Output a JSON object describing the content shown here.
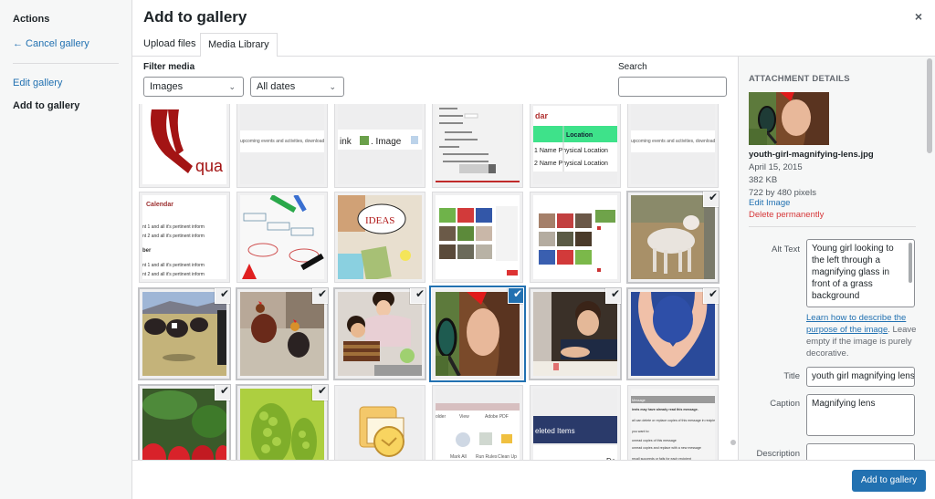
{
  "menu": {
    "heading": "Actions",
    "cancel": "← Cancel gallery",
    "edit": "Edit gallery",
    "active": "Add to gallery"
  },
  "modal": {
    "title": "Add to gallery",
    "close_icon": "×"
  },
  "tabs": [
    {
      "label": "Upload files",
      "active": false
    },
    {
      "label": "Media Library",
      "active": true
    }
  ],
  "toolbar": {
    "filter_label": "Filter media",
    "type_filter": "Images",
    "date_filter": "All dates",
    "search_label": "Search",
    "search_value": ""
  },
  "grid": {
    "items": [
      {
        "desc": "qua logo (red Q)",
        "selected": false
      },
      {
        "desc": "upcoming events text strip",
        "text": "upcoming events and activities, download",
        "selected": false
      },
      {
        "desc": "ink Image toolbar",
        "text": "ink  . Image",
        "selected": false
      },
      {
        "desc": "table properties dialog",
        "selected": false
      },
      {
        "desc": "calendar table",
        "text_a": "dar",
        "text_b": "Location",
        "text_c": "1 Name  Physical Location",
        "text_d": "2 Name  Physical Location",
        "selected": false
      },
      {
        "desc": "upcoming events text strip",
        "text": "upcoming events and activities, download",
        "selected": false
      },
      {
        "desc": "calendar document",
        "text_a": "Calendar",
        "text_b": "nt 1 and all it's pertinent inform",
        "text_c": "nt 2 and all it's pertinent inform",
        "text_d": "ber",
        "selected": false
      },
      {
        "desc": "flowchart with markers",
        "selected": false
      },
      {
        "desc": "IDEAS sketch board",
        "text": "IDEAS",
        "selected": false
      },
      {
        "desc": "edit gallery screenshot",
        "selected": false
      },
      {
        "desc": "create gallery screenshot",
        "selected": false
      },
      {
        "desc": "lamb",
        "selected": true
      },
      {
        "desc": "cows in field",
        "selected": true
      },
      {
        "desc": "chickens",
        "selected": true
      },
      {
        "desc": "mother and son washing lettuce",
        "selected": true
      },
      {
        "desc": "girl with magnifying glass",
        "selected": true,
        "details": true
      },
      {
        "desc": "boy writing",
        "selected": true
      },
      {
        "desc": "blueberries in hands",
        "selected": true
      },
      {
        "desc": "strawberries",
        "selected": true
      },
      {
        "desc": "green grapes",
        "selected": true
      },
      {
        "desc": "outlook icon",
        "selected": false
      },
      {
        "desc": "outlook ribbon",
        "text_a": "older  View  Adobe PDF",
        "text_b": "Mark All as Read  Run Rules Now  Clean Up Folder",
        "selected": false
      },
      {
        "desc": "deleted items banner",
        "text": "eleted Items",
        "selected": false
      },
      {
        "desc": "recall message dialog",
        "text": "ients may have already read this message.",
        "selected": false
      }
    ]
  },
  "details": {
    "heading": "Attachment Details",
    "filename": "youth-girl-magnifying-lens.jpg",
    "date": "April 15, 2015",
    "size": "382 KB",
    "dimensions": "722 by 480 pixels",
    "edit_link": "Edit Image",
    "delete_link": "Delete permanently",
    "alt_label": "Alt Text",
    "alt_value": "Young girl looking to the left through a magnifying glass in front of a grass background",
    "help_link": "Learn how to describe the purpose of the image",
    "help_text": ". Leave empty if the image is purely decorative.",
    "title_label": "Title",
    "title_value": "youth girl magnifying lens",
    "caption_label": "Caption",
    "caption_value": "Magnifying lens",
    "description_label": "Description",
    "description_value": ""
  },
  "footer": {
    "primary_button": "Add to gallery"
  },
  "colors": {
    "accent": "#2271b1",
    "danger": "#d63638",
    "sidebar_bg": "#f6f7f7"
  }
}
